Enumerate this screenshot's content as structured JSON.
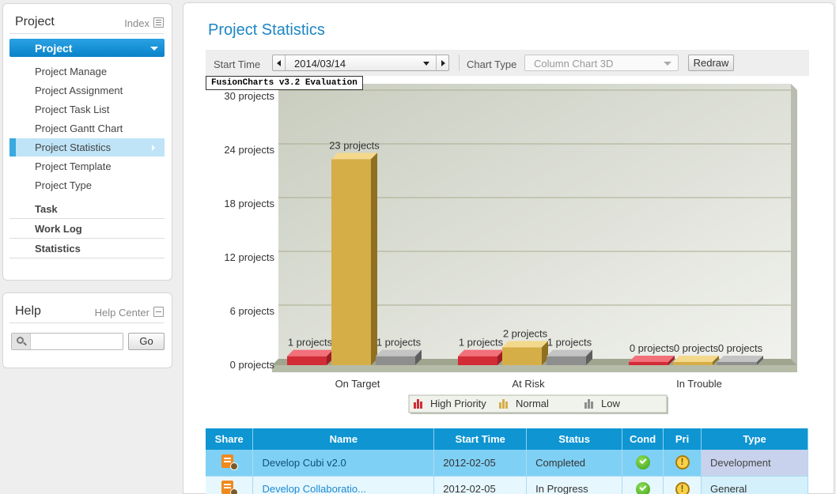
{
  "sidebar": {
    "project_panel": {
      "title": "Project",
      "index_link": "Index",
      "section": "Project",
      "items": [
        {
          "label": "Project Manage"
        },
        {
          "label": "Project Assignment"
        },
        {
          "label": "Project Task List"
        },
        {
          "label": "Project Gantt Chart"
        },
        {
          "label": "Project Statistics",
          "active": true
        },
        {
          "label": "Project Template"
        },
        {
          "label": "Project Type"
        }
      ],
      "groups": [
        {
          "label": "Task"
        },
        {
          "label": "Work Log"
        },
        {
          "label": "Statistics"
        }
      ]
    },
    "help_panel": {
      "title": "Help",
      "link": "Help Center",
      "search_value": "",
      "go_label": "Go"
    }
  },
  "main": {
    "title": "Project Statistics",
    "toolbar": {
      "start_time_label": "Start Time",
      "start_time_value": "2014/03/14",
      "chart_type_label": "Chart Type",
      "chart_type_value": "Column Chart 3D",
      "redraw_label": "Redraw"
    },
    "eval_badge": "FusionCharts v3.2 Evaluation"
  },
  "chart_data": {
    "type": "bar",
    "categories": [
      "On Target",
      "At Risk",
      "In Trouble"
    ],
    "series": [
      {
        "name": "High Priority",
        "values": [
          1,
          1,
          0
        ],
        "color": "#e0303a"
      },
      {
        "name": "Normal",
        "values": [
          23,
          2,
          0
        ],
        "color": "#d9b24a"
      },
      {
        "name": "Low",
        "values": [
          1,
          1,
          0
        ],
        "color": "#8a8a8a"
      }
    ],
    "data_labels": [
      [
        "1 projects",
        "1 projects",
        "0 projects"
      ],
      [
        "23 projects",
        "2 projects",
        "0 projects"
      ],
      [
        "1 projects",
        "1 projects",
        "0 projects"
      ]
    ],
    "y_ticks": [
      {
        "value": 0,
        "label": "0 projects"
      },
      {
        "value": 6,
        "label": "6 projects"
      },
      {
        "value": 12,
        "label": "12 projects"
      },
      {
        "value": 18,
        "label": "18 projects"
      },
      {
        "value": 24,
        "label": "24 projects"
      },
      {
        "value": 30,
        "label": "30 projects"
      }
    ],
    "ylim": [
      0,
      30
    ],
    "grid": true,
    "legend": "bottom"
  },
  "table": {
    "columns": [
      "Share",
      "Name",
      "Start Time",
      "Status",
      "Cond",
      "Pri",
      "Type"
    ],
    "rows": [
      {
        "name": "Develop Cubi v2.0",
        "start": "2012-02-05",
        "status": "Completed",
        "cond": "check-icon",
        "pri": "warning-icon",
        "type": "Development"
      },
      {
        "name": "Develop Collaboratio...",
        "start": "2012-02-05",
        "status": "In Progress",
        "cond": "check-icon",
        "pri": "warning-icon",
        "type": "General"
      }
    ]
  }
}
